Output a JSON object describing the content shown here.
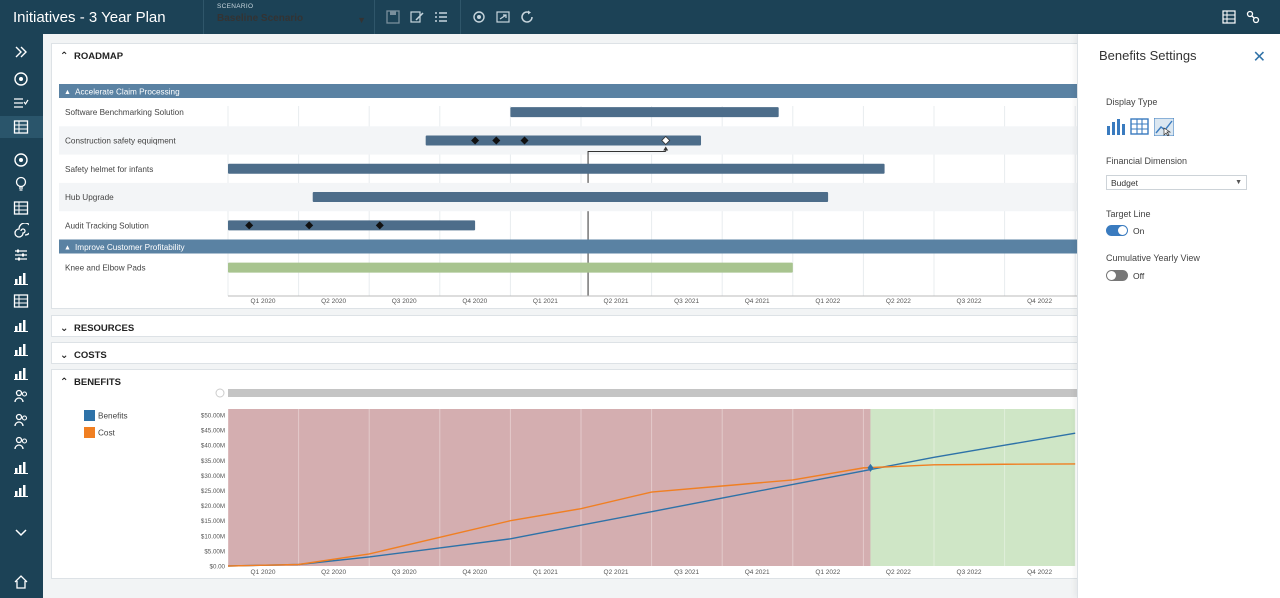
{
  "header": {
    "title": "Initiatives - 3 Year Plan",
    "scenario_caption": "SCENARIO",
    "scenario_value": "Baseline Scenario",
    "icons": [
      "save-icon",
      "edit-icon",
      "list-icon",
      "settings-icon",
      "export-icon",
      "refresh-icon",
      "layout-icon",
      "link-icon"
    ]
  },
  "sidebar": {
    "icons": [
      "expand-icon",
      "dashboard-icon",
      "list-check-icon",
      "roadmap-icon",
      "target-icon",
      "idea-icon",
      "table-icon",
      "spiral-icon",
      "sliders-icon",
      "chart-icon",
      "grid-chart-icon",
      "chart-icon",
      "chart-icon",
      "chart-icon",
      "people-icon",
      "grid-people-icon",
      "people-icon",
      "chart-icon",
      "chart-icon",
      "chevron-down-icon",
      "home-icon"
    ]
  },
  "roadmap": {
    "title": "ROADMAP",
    "timeline": [
      "Q1 2020",
      "Q2 2020",
      "Q3 2020",
      "Q4 2020",
      "Q1 2021",
      "Q2 2021",
      "Q3 2021",
      "Q4 2021",
      "Q1 2022",
      "Q2 2022",
      "Q3 2022",
      "Q4 2022"
    ],
    "groups": [
      {
        "name": "Accelerate Claim Processing",
        "rows": [
          {
            "name": "Software Benchmarking Solution",
            "start": 4.0,
            "end": 7.8,
            "color": "#4d6d8a",
            "milestones": []
          },
          {
            "name": "Construction safety equiqment",
            "start": 2.8,
            "end": 6.7,
            "color": "#4d6d8a",
            "milestones": [
              3.5,
              3.8,
              4.2
            ],
            "open_milestone": 6.2
          },
          {
            "name": "Safety helmet for infants",
            "start": 0.0,
            "end": 9.3,
            "color": "#4d6d8a",
            "milestones": []
          },
          {
            "name": "Hub Upgrade",
            "start": 1.2,
            "end": 8.5,
            "color": "#4d6d8a",
            "milestones": []
          },
          {
            "name": "Audit Tracking Solution",
            "start": 0.0,
            "end": 3.5,
            "color": "#4d6d8a",
            "milestones": [
              0.3,
              1.15,
              2.15
            ]
          }
        ]
      },
      {
        "name": "Improve Customer Profitability",
        "rows": [
          {
            "name": "Knee and Elbow Pads",
            "start": 0.0,
            "end": 8.0,
            "color": "#a8c48f",
            "milestones": []
          }
        ]
      }
    ]
  },
  "resources": {
    "title": "RESOURCES"
  },
  "costs": {
    "title": "COSTS"
  },
  "benefits_section": {
    "title": "BENEFITS"
  },
  "chart_data": {
    "type": "line",
    "title": "",
    "x": [
      "Q1 2020",
      "Q2 2020",
      "Q3 2020",
      "Q4 2020",
      "Q1 2021",
      "Q2 2021",
      "Q3 2021",
      "Q4 2021",
      "Q1 2022",
      "Q2 2022",
      "Q3 2022",
      "Q4 2022"
    ],
    "series": [
      {
        "name": "Benefits",
        "color": "#2e72a8",
        "values": [
          0.5,
          3,
          6,
          9,
          13.5,
          18,
          22.5,
          27,
          31.5,
          36,
          40,
          44
        ]
      },
      {
        "name": "Cost",
        "color": "#f07f22",
        "values": [
          0.5,
          4,
          9.5,
          15,
          19,
          24.5,
          26.5,
          28.5,
          32.5,
          33.5,
          33.7,
          33.8
        ]
      }
    ],
    "y_ticks": [
      "$0.00",
      "$5.00M",
      "$10.00M",
      "$15.00M",
      "$20.00M",
      "$25.00M",
      "$30.00M",
      "$35.00M",
      "$40.00M",
      "$45.00M",
      "$50.00M"
    ],
    "ylim": [
      0,
      52
    ],
    "regions": [
      {
        "from": 0,
        "to": 9.1,
        "color": "#d4aeb0"
      },
      {
        "from": 9.1,
        "to": 12,
        "color": "#cfe6c6"
      }
    ],
    "legend_position": "left",
    "grid": true
  },
  "settings": {
    "title": "Benefits Settings",
    "display_type_label": "Display Type",
    "financial_dimension_label": "Financial Dimension",
    "financial_dimension_value": "Budget",
    "target_line_label": "Target Line",
    "target_line_state": "On",
    "cumulative_label": "Cumulative Yearly View",
    "cumulative_state": "Off",
    "accent_color": "#3a7bbf"
  }
}
